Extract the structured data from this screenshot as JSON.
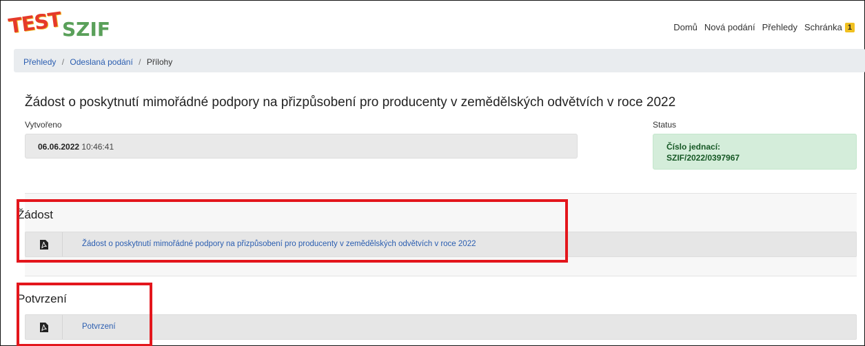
{
  "header": {
    "logo_test": "TEST",
    "logo_szif": "SZIF",
    "nav": [
      {
        "label": "Domů"
      },
      {
        "label": "Nová podání"
      },
      {
        "label": "Přehledy"
      },
      {
        "label": "Schránka"
      }
    ],
    "inbox_badge": "1"
  },
  "breadcrumb": {
    "items": [
      "Přehledy",
      "Odeslaná podání",
      "Přílohy"
    ],
    "separator": "/"
  },
  "detail": {
    "title": "Žádost o poskytnutí mimořádné podpory na přizpůsobení pro producenty v zemědělských odvětvích v roce 2022",
    "created_label": "Vytvořeno",
    "created_date": "06.06.2022",
    "created_time": "10:46:41",
    "status_label": "Status",
    "status_line1": "Číslo jednací:",
    "status_line2": "SZIF/2022/0397967"
  },
  "sections": [
    {
      "title": "Žádost",
      "attachment": {
        "icon": "pdf-icon",
        "label": "Žádost o poskytnutí mimořádné podpory na přizpůsobení pro producenty v zemědělských odvětvích v roce 2022"
      }
    },
    {
      "title": "Potvrzení",
      "attachment": {
        "icon": "pdf-icon",
        "label": "Potvrzení"
      }
    }
  ],
  "colors": {
    "link": "#2a5db0",
    "highlight": "#e3161c",
    "status_bg": "#d4edda",
    "badge": "#f0c020"
  }
}
